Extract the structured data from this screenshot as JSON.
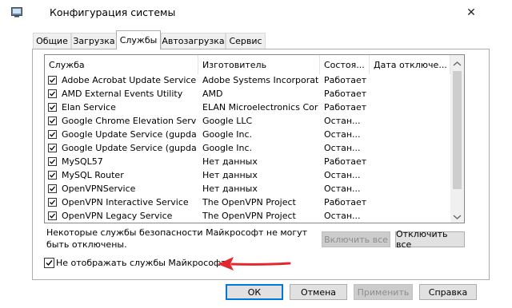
{
  "window": {
    "title": "Конфигурация системы",
    "app_icon": "msconfig-icon",
    "close_glyph": "✕"
  },
  "tabs": [
    {
      "label": "Общие",
      "active": false
    },
    {
      "label": "Загрузка",
      "active": false
    },
    {
      "label": "Службы",
      "active": true
    },
    {
      "label": "Автозагрузка",
      "active": false
    },
    {
      "label": "Сервис",
      "active": false
    }
  ],
  "services": {
    "columns": [
      "Служба",
      "Изготовитель",
      "Состоя...",
      "Дата отключе..."
    ],
    "rows": [
      {
        "name": "Adobe Acrobat Update Service",
        "vendor": "Adobe Systems Incorporated",
        "status": "Работает",
        "checked": true
      },
      {
        "name": "AMD External Events Utility",
        "vendor": "AMD",
        "status": "Работает",
        "checked": true
      },
      {
        "name": "Elan Service",
        "vendor": "ELAN Microelectronics Corp.",
        "status": "Работает",
        "checked": true
      },
      {
        "name": "Google Chrome Elevation Service",
        "vendor": "Google LLC",
        "status": "Остан...",
        "checked": true
      },
      {
        "name": "Google Update Service (gupdate)",
        "vendor": "Google Inc.",
        "status": "Остан...",
        "checked": true
      },
      {
        "name": "Google Update Service (gupdatem)",
        "vendor": "Google Inc.",
        "status": "Остан...",
        "checked": true
      },
      {
        "name": "MySQL57",
        "vendor": "Нет данных",
        "status": "Работает",
        "checked": true
      },
      {
        "name": "MySQL Router",
        "vendor": "Нет данных",
        "status": "Остан...",
        "checked": true
      },
      {
        "name": "OpenVPNService",
        "vendor": "Нет данных",
        "status": "Остан...",
        "checked": true
      },
      {
        "name": "OpenVPN Interactive Service",
        "vendor": "The OpenVPN Project",
        "status": "Работает",
        "checked": true
      },
      {
        "name": "OpenVPN Legacy Service",
        "vendor": "The OpenVPN Project",
        "status": "Остан...",
        "checked": true
      }
    ]
  },
  "note": "Некоторые службы безопасности Майкрософт не могут быть отключены.",
  "enable_all_label": "Включить все",
  "disable_all_label": "Отключить все",
  "hide_ms_label": "Не отображать службы Майкрософт",
  "hide_ms_checked": true,
  "annotation_arrow_color": "#e0282e",
  "footer": {
    "ok": "ОК",
    "cancel": "Отмена",
    "apply": "Применить",
    "help": "Справка"
  }
}
